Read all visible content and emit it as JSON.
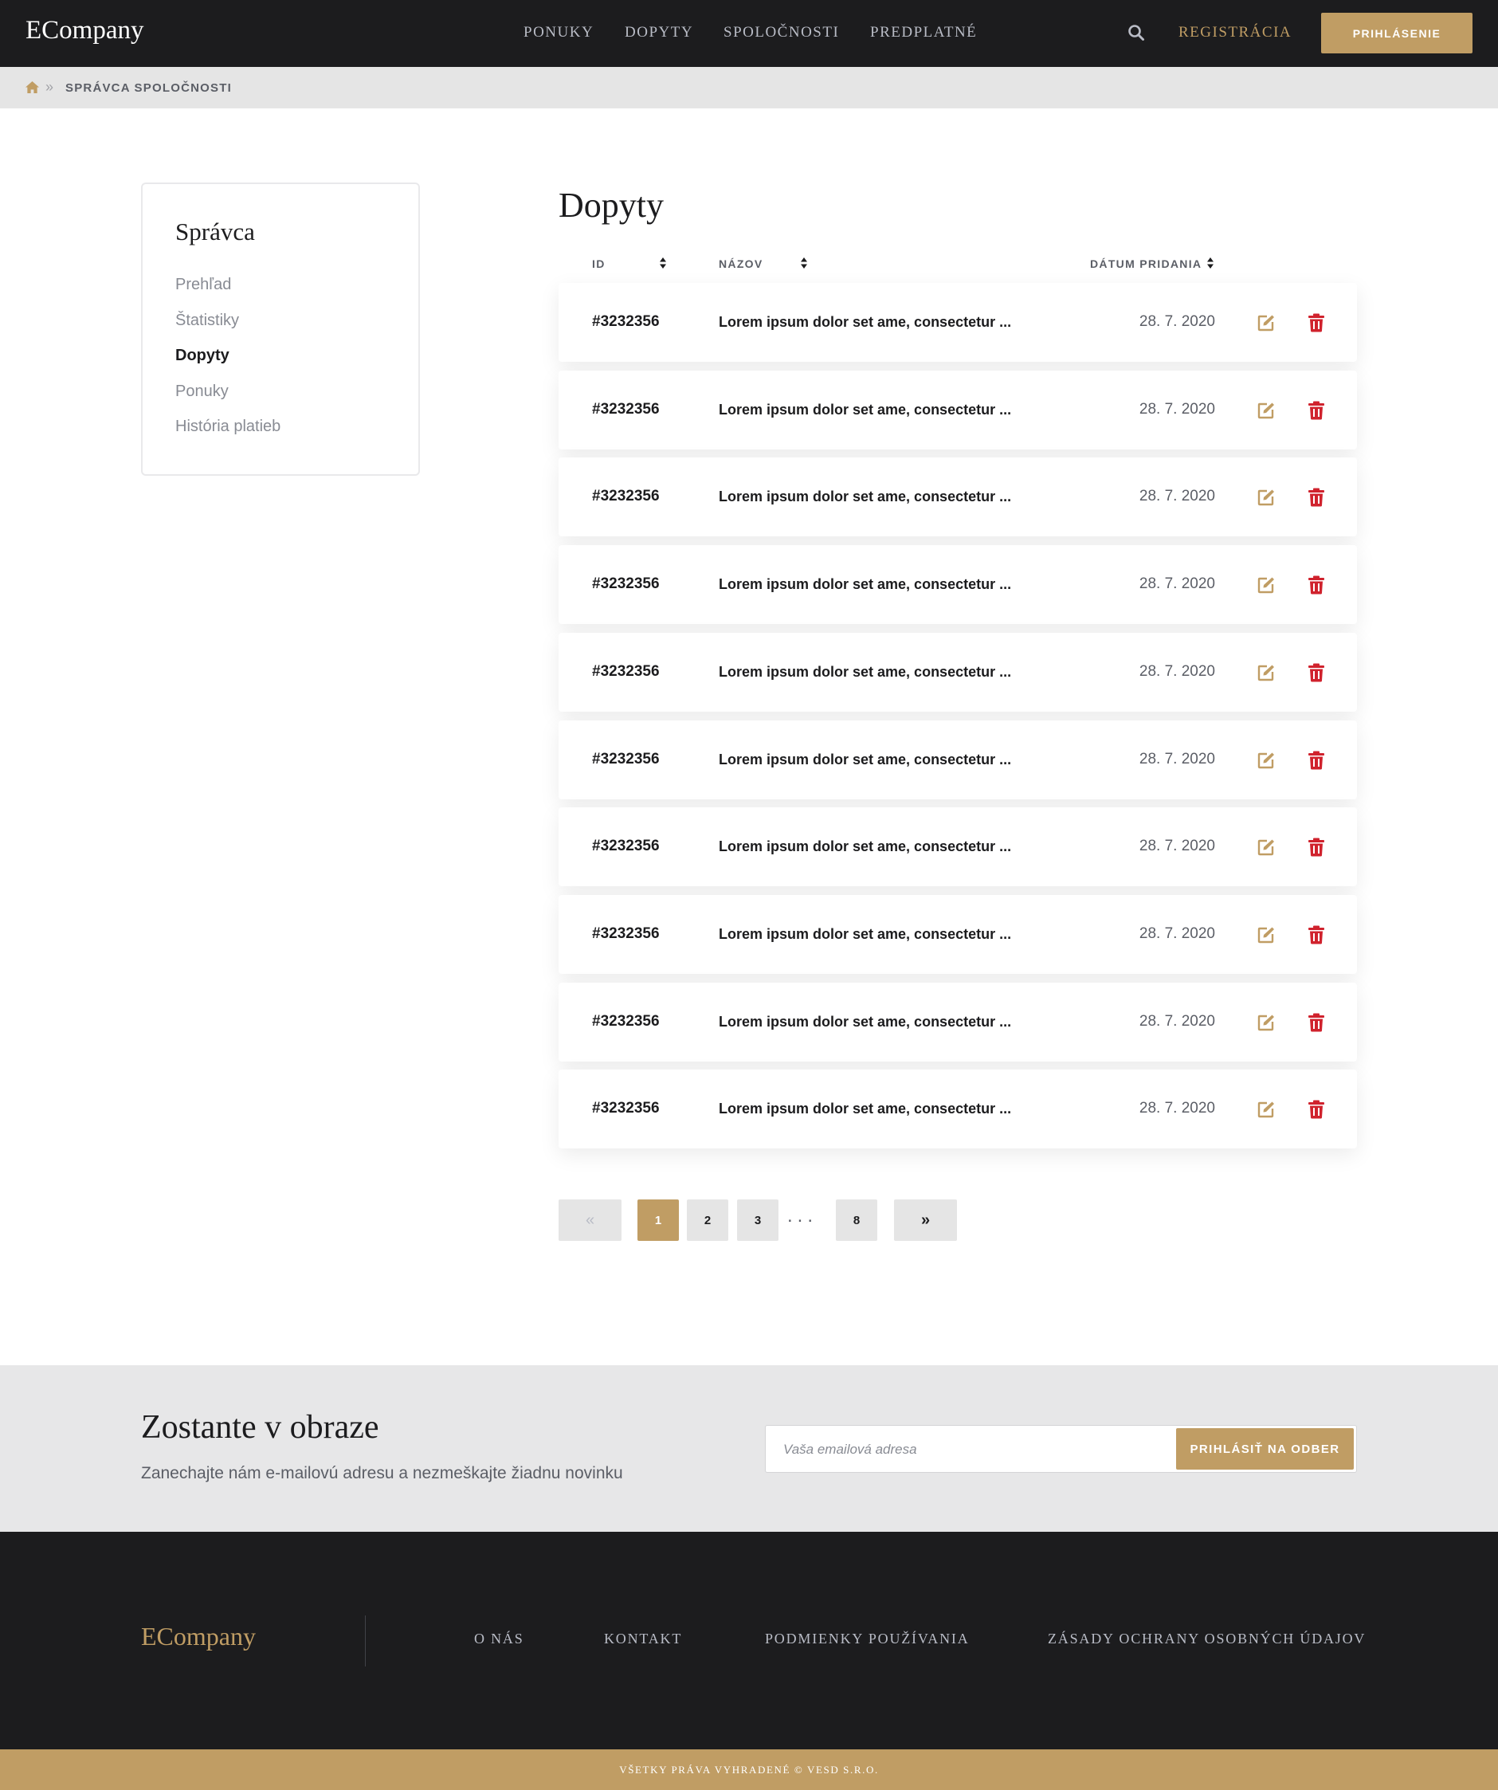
{
  "header": {
    "logo": "ECompany",
    "nav": [
      "PONUKY",
      "DOPYTY",
      "SPOLOČNOSTI",
      "PREDPLATNÉ"
    ],
    "register_label": "REGISTRÁCIA",
    "login_label": "PRIHLÁSENIE"
  },
  "breadcrumb": {
    "separator": "»",
    "current": "SPRÁVCA SPOLOČNOSTI"
  },
  "sidebar": {
    "title": "Správca",
    "items": [
      {
        "label": "Prehľad",
        "active": false
      },
      {
        "label": "Štatistiky",
        "active": false
      },
      {
        "label": "Dopyty",
        "active": true
      },
      {
        "label": "Ponuky",
        "active": false
      },
      {
        "label": "História platieb",
        "active": false
      }
    ]
  },
  "content": {
    "title": "Dopyty",
    "columns": {
      "id": "ID",
      "name": "NÁZOV",
      "date": "DÁTUM PRIDANIA"
    },
    "rows": [
      {
        "id": "#3232356",
        "name": "Lorem ipsum dolor set ame, consectetur ...",
        "date": "28. 7. 2020"
      },
      {
        "id": "#3232356",
        "name": "Lorem ipsum dolor set ame, consectetur ...",
        "date": "28. 7. 2020"
      },
      {
        "id": "#3232356",
        "name": "Lorem ipsum dolor set ame, consectetur ...",
        "date": "28. 7. 2020"
      },
      {
        "id": "#3232356",
        "name": "Lorem ipsum dolor set ame, consectetur ...",
        "date": "28. 7. 2020"
      },
      {
        "id": "#3232356",
        "name": "Lorem ipsum dolor set ame, consectetur ...",
        "date": "28. 7. 2020"
      },
      {
        "id": "#3232356",
        "name": "Lorem ipsum dolor set ame, consectetur ...",
        "date": "28. 7. 2020"
      },
      {
        "id": "#3232356",
        "name": "Lorem ipsum dolor set ame, consectetur ...",
        "date": "28. 7. 2020"
      },
      {
        "id": "#3232356",
        "name": "Lorem ipsum dolor set ame, consectetur ...",
        "date": "28. 7. 2020"
      },
      {
        "id": "#3232356",
        "name": "Lorem ipsum dolor set ame, consectetur ...",
        "date": "28. 7. 2020"
      },
      {
        "id": "#3232356",
        "name": "Lorem ipsum dolor set ame, consectetur ...",
        "date": "28. 7. 2020"
      }
    ],
    "icons": {
      "edit": "edit-icon",
      "delete": "trash-icon",
      "sort": "sort-icon"
    }
  },
  "pagination": {
    "first": "«",
    "pages": [
      "1",
      "2",
      "3"
    ],
    "ellipsis": "...",
    "last_page": "8",
    "last": "»",
    "current": "1"
  },
  "newsletter": {
    "title": "Zostante v obraze",
    "subtitle": "Zanechajte nám e-mailovú adresu a nezmeškajte žiadnu novinku",
    "placeholder": "Vaša emailová adresa",
    "button": "PRIHLÁSIŤ NA ODBER"
  },
  "footer": {
    "logo": "ECompany",
    "links": [
      "O NÁS",
      "KONTAKT",
      "PODMIENKY POUŽÍVANIA",
      "ZÁSADY OCHRANY OSOBNÝCH ÚDAJOV"
    ],
    "copyright": "VŠETKY PRÁVA VYHRADENÉ © VESD S.R.O."
  },
  "colors": {
    "accent": "#c09d64",
    "dark": "#1c1c1e",
    "delete": "#d0222d",
    "light_bg": "#e7e7e8"
  }
}
